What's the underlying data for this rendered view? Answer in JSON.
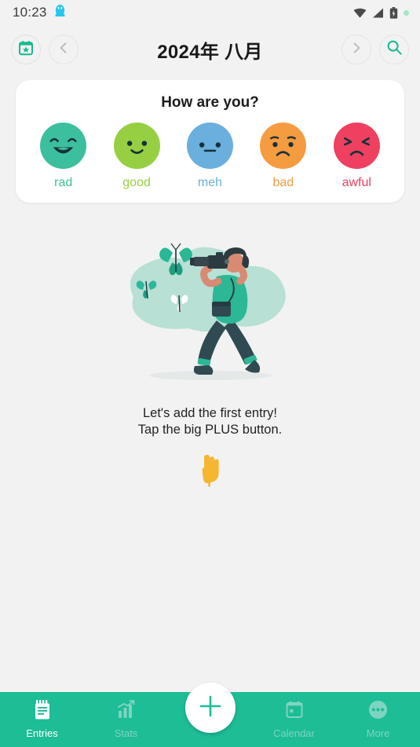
{
  "status_bar": {
    "time": "10:23",
    "notification_icon": "qq-penguin-icon",
    "icons": [
      "wifi-icon",
      "signal-icon",
      "battery-icon",
      "green-dot-indicator"
    ]
  },
  "header": {
    "today_button_icon": "calendar-star-icon",
    "prev_button_icon": "chevron-left-icon",
    "title": "2024年 八月",
    "next_button_icon": "chevron-right-icon",
    "search_button_icon": "search-icon"
  },
  "mood_card": {
    "title": "How are you?",
    "moods": [
      {
        "label": "rad",
        "color": "#3cbf9c",
        "text_color": "#3cbf9c",
        "face": "grin"
      },
      {
        "label": "good",
        "color": "#97cf43",
        "text_color": "#97cf43",
        "face": "smile"
      },
      {
        "label": "meh",
        "color": "#6aafdd",
        "text_color": "#6aafdd",
        "face": "neutral"
      },
      {
        "label": "bad",
        "color": "#f59b40",
        "text_color": "#f59b40",
        "face": "sad"
      },
      {
        "label": "awful",
        "color": "#ef4060",
        "text_color": "#ef4060",
        "face": "awful"
      }
    ]
  },
  "empty_state": {
    "illustration": "photographer-with-butterflies-illustration",
    "line1": "Let's add the first entry!",
    "line2": "Tap the big PLUS button.",
    "pointer_icon": "pointing-down-hand-icon"
  },
  "bottom_nav": {
    "accent_color": "#1dbd96",
    "items": [
      {
        "label": "Entries",
        "icon": "notepad-icon",
        "active": true
      },
      {
        "label": "Stats",
        "icon": "bar-chart-icon",
        "active": false
      },
      {
        "label": "Calendar",
        "icon": "calendar-icon",
        "active": false
      },
      {
        "label": "More",
        "icon": "more-dots-icon",
        "active": false
      }
    ],
    "fab": {
      "icon": "plus-icon",
      "color": "#1dbd96"
    }
  }
}
